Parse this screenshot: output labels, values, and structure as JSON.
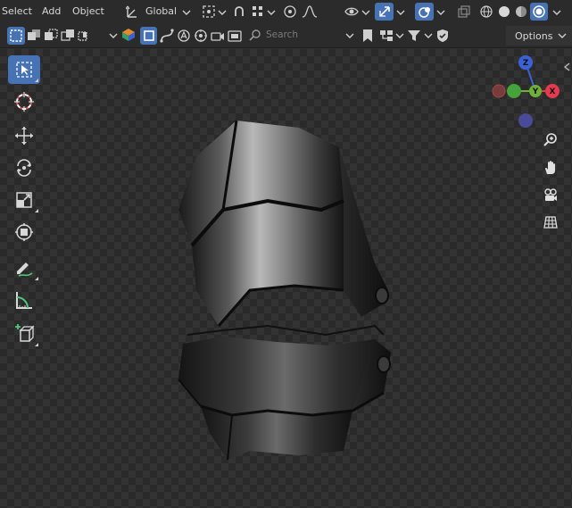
{
  "menu": {
    "select": "Select",
    "add": "Add",
    "object": "Object"
  },
  "transform_orientation": "Global",
  "search": {
    "placeholder": "Search"
  },
  "options_label": "Options",
  "gizmo": {
    "z": "Z",
    "y": "Y",
    "x": "X"
  },
  "icons": [
    "cursor-icon",
    "transform-pivot-icon",
    "snap-icon",
    "proportional-editing-icon",
    "visibility-icon",
    "gizmo-icon",
    "overlay-icon",
    "xray-icon",
    "wireframe-shading-icon",
    "solid-shading-icon",
    "material-shading-icon",
    "rendered-shading-icon",
    "zoom-icon",
    "hand-icon",
    "camera-icon",
    "grid-icon"
  ],
  "colors": {
    "accent": "#4772b3",
    "axis_x": "#e53a4f",
    "axis_y": "#6fb03a",
    "axis_z": "#3a62d6"
  }
}
